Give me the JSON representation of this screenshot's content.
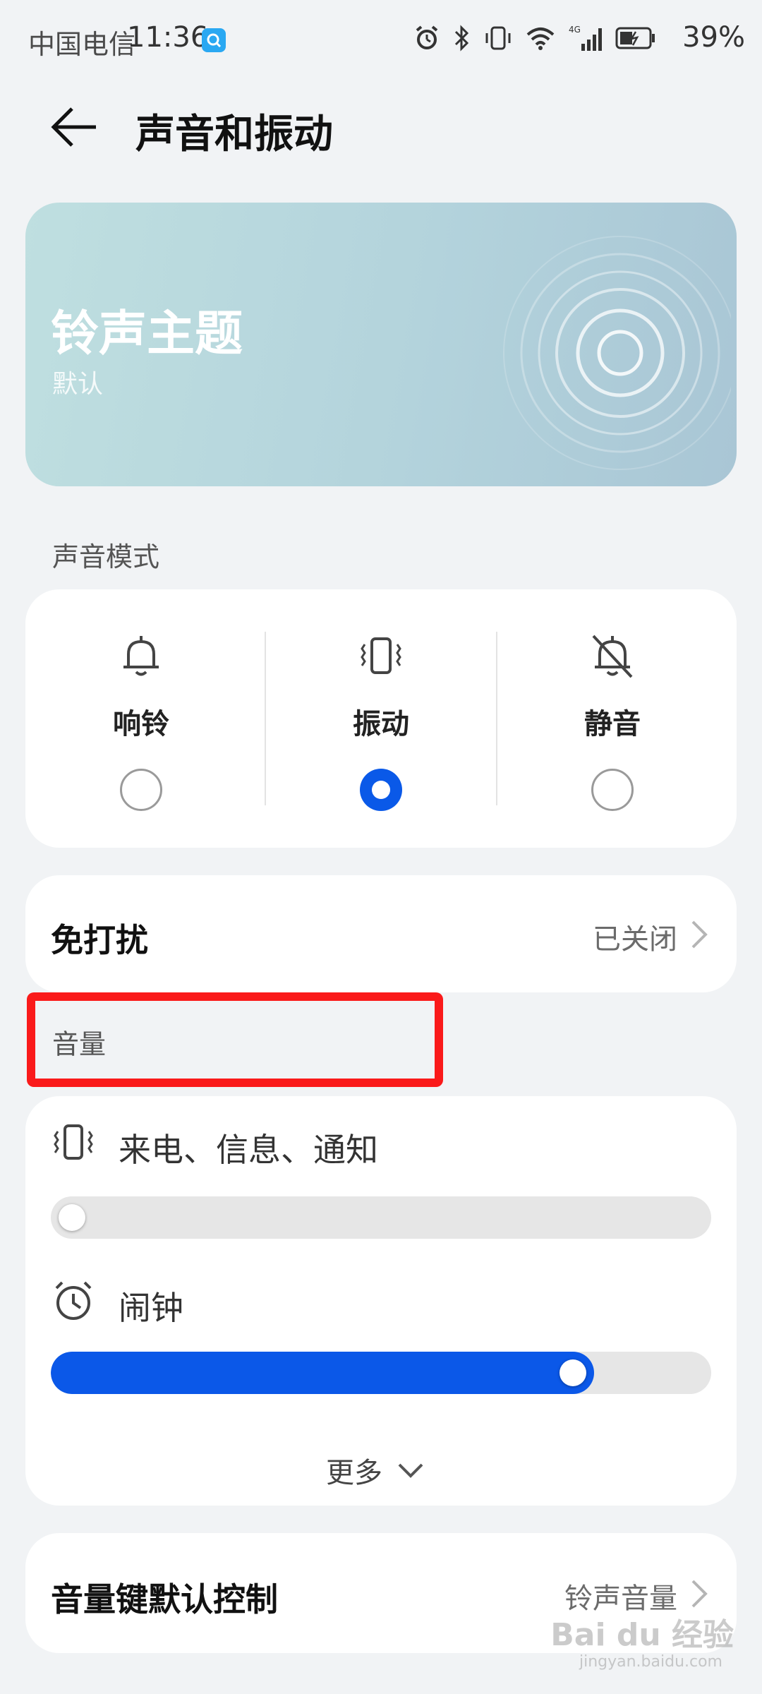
{
  "status_bar": {
    "carrier": "中国电信",
    "time": "11:36",
    "battery": "39%",
    "icons": [
      "alarm-icon",
      "bluetooth-icon",
      "vibrate-icon",
      "wifi-icon",
      "signal-4g-icon",
      "battery-icon"
    ]
  },
  "header": {
    "title": "声音和振动",
    "back_icon": "arrow-left-icon"
  },
  "ringtone": {
    "title": "铃声主题",
    "subtitle": "默认"
  },
  "sound_mode": {
    "label": "声音模式",
    "options": [
      {
        "label": "响铃",
        "icon": "bell-icon",
        "selected": false
      },
      {
        "label": "振动",
        "icon": "vibrate-icon",
        "selected": true
      },
      {
        "label": "静音",
        "icon": "bell-off-icon",
        "selected": false
      }
    ]
  },
  "dnd": {
    "title": "免打扰",
    "value": "已关闭"
  },
  "volume": {
    "label": "音量",
    "items": [
      {
        "label": "来电、信息、通知",
        "icon": "vibrate-icon",
        "level": 0.0
      },
      {
        "label": "闹钟",
        "icon": "alarm-clock-icon",
        "level": 0.81
      }
    ],
    "more": "更多"
  },
  "volume_key": {
    "title": "音量键默认控制",
    "value": "铃声音量"
  },
  "watermark": {
    "text": "Bai du 经验",
    "sub": "jingyan.baidu.com"
  },
  "colors": {
    "accent": "#0a59e8",
    "highlight": "#fa1a1a",
    "background": "#f1f3f5"
  }
}
